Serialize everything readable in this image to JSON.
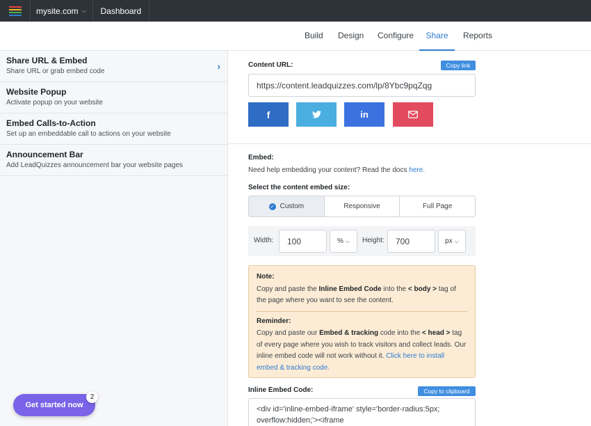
{
  "topbar": {
    "logo_colors": [
      "#e8453c",
      "#f0b429",
      "#4caf50",
      "#2f7bd1"
    ],
    "site": "mysite.com",
    "dashboard": "Dashboard"
  },
  "tabs": [
    {
      "label": "Build"
    },
    {
      "label": "Design"
    },
    {
      "label": "Configure"
    },
    {
      "label": "Share"
    },
    {
      "label": "Reports"
    }
  ],
  "sidebar": {
    "items": [
      {
        "title": "Share URL & Embed",
        "sub": "Share URL or grab embed code"
      },
      {
        "title": "Website Popup",
        "sub": "Activate popup on your website"
      },
      {
        "title": "Embed Calls-to-Action",
        "sub": "Set up an embeddable call to actions on your website"
      },
      {
        "title": "Announcement Bar",
        "sub": "Add LeadQuizzes announcement bar your website pages"
      }
    ],
    "get_started": "Get started now",
    "badge": "2"
  },
  "content": {
    "url_label": "Content URL:",
    "copy_link": "Copy link",
    "url_value": "https://content.leadquizzes.com/lp/8Ybc9pqZqg",
    "social": [
      {
        "icon": "facebook-icon",
        "glyph": "f",
        "color": "#2f6cc4"
      },
      {
        "icon": "twitter-icon",
        "glyph": "🐦",
        "color": "#4aaee0"
      },
      {
        "icon": "linkedin-icon",
        "glyph": "in",
        "color": "#3b72e0"
      },
      {
        "icon": "email-icon",
        "glyph": "✉",
        "color": "#e24a5e"
      }
    ]
  },
  "embed": {
    "label": "Embed:",
    "help_text": "Need help embedding your content? Read the docs",
    "help_link": "here.",
    "size_label": "Select the content embed size:",
    "sizes": [
      "Custom",
      "Responsive",
      "Full Page"
    ],
    "width_label": "Width:",
    "width_value": "100",
    "width_unit": "%",
    "height_label": "Height:",
    "height_value": "700",
    "height_unit": "px"
  },
  "note": {
    "title": "Note:",
    "line1_a": "Copy and paste the ",
    "line1_b": "Inline Embed Code",
    "line1_c": " into the ",
    "line1_d": "< body >",
    "line1_e": " tag of the page where you want to see the content.",
    "reminder_title": "Reminder:",
    "r_a": "Copy and paste our ",
    "r_b": "Embed & tracking",
    "r_c": " code into the ",
    "r_d": "< head >",
    "r_e": " tag of every page where you wish to track visitors and collect leads. Our inline embed code will not work without it. ",
    "r_link": "Click here to install embed & tracking code."
  },
  "inline": {
    "label": "Inline Embed Code:",
    "copy": "Copy to clipboard",
    "code": "<div id='inline-embed-iframe' style='border-radius:5px; overflow:hidden;'><iframe"
  }
}
